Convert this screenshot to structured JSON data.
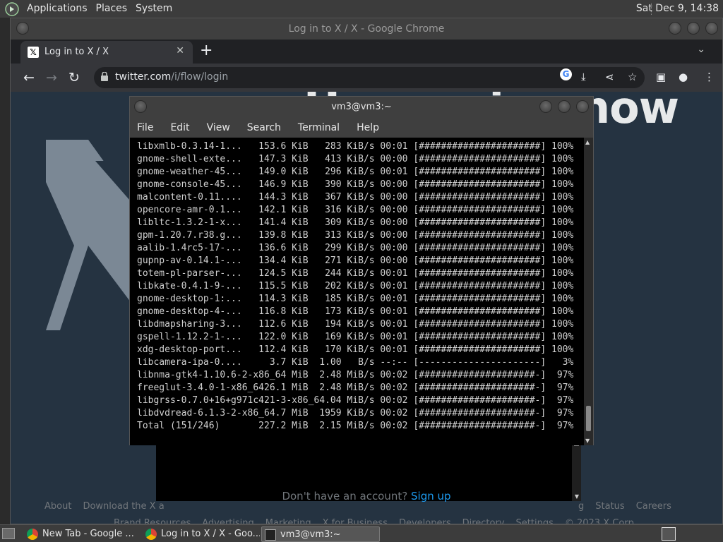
{
  "top_panel": {
    "menus": [
      "Applications",
      "Places",
      "System"
    ],
    "clock": "Sat Dec 9, 14:38"
  },
  "chrome": {
    "window_title": "Log in to X / X - Google Chrome",
    "tab_title": "Log in to X / X",
    "url_host": "twitter.com",
    "url_path": "/i/flow/login"
  },
  "page": {
    "heading_partial": "Happening now",
    "dont_have_account": "Don't have an account?",
    "sign_up": "Sign up",
    "footer_row1": [
      "About",
      "Download the X a",
      "g",
      "Status",
      "Careers"
    ],
    "footer_row2": [
      "Brand Resources",
      "Advertising",
      "Marketing",
      "X for Business",
      "Developers",
      "Directory",
      "Settings",
      "© 2023 X Corp."
    ]
  },
  "terminal": {
    "title": "vm3@vm3:~",
    "menus": [
      "File",
      "Edit",
      "View",
      "Search",
      "Terminal",
      "Help"
    ],
    "lines": [
      "libxmlb-0.3.14-1...   153.6 KiB   283 KiB/s 00:01 [######################] 100%",
      "gnome-shell-exte...   147.3 KiB   413 KiB/s 00:00 [######################] 100%",
      "gnome-weather-45...   149.0 KiB   296 KiB/s 00:01 [######################] 100%",
      "gnome-console-45...   146.9 KiB   390 KiB/s 00:00 [######################] 100%",
      "malcontent-0.11....   144.3 KiB   367 KiB/s 00:00 [######################] 100%",
      "opencore-amr-0.1...   142.1 KiB   316 KiB/s 00:00 [######################] 100%",
      "libltc-1.3.2-1-x...   141.4 KiB   309 KiB/s 00:00 [######################] 100%",
      "gpm-1.20.7.r38.g...   139.8 KiB   313 KiB/s 00:00 [######################] 100%",
      "aalib-1.4rc5-17-...   136.6 KiB   299 KiB/s 00:00 [######################] 100%",
      "gupnp-av-0.14.1-...   134.4 KiB   271 KiB/s 00:00 [######################] 100%",
      "totem-pl-parser-...   124.5 KiB   244 KiB/s 00:01 [######################] 100%",
      "libkate-0.4.1-9-...   115.5 KiB   202 KiB/s 00:01 [######################] 100%",
      "gnome-desktop-1:...   114.3 KiB   185 KiB/s 00:01 [######################] 100%",
      "gnome-desktop-4-...   116.8 KiB   173 KiB/s 00:01 [######################] 100%",
      "libdmapsharing-3...   112.6 KiB   194 KiB/s 00:01 [######################] 100%",
      "gspell-1.12.2-1-...   122.0 KiB   169 KiB/s 00:01 [######################] 100%",
      "xdg-desktop-port...   112.4 KiB   170 KiB/s 00:01 [######################] 100%",
      "libcamera-ipa-0....     3.7 KiB  1.00   B/s --:-- [----------------------]   3%",
      "libnma-gtk4-1.10.6-2-x86_64 MiB  2.48 MiB/s 00:02 [#####################-]  97%",
      "freeglut-3.4.0-1-x86_6426.1 MiB  2.48 MiB/s 00:02 [#####################-]  97%",
      "libgrss-0.7.0+16+g971c421-3-x86_64.04 MiB/s 00:02 [#####################-]  97%",
      "libdvdread-6.1.3-2-x86_64.7 MiB  1959 KiB/s 00:02 [#####################-]  97%",
      "Total (151/246)       227.2 MiB  2.15 MiB/s 00:02 [#####################-]  97%"
    ]
  },
  "taskbar": {
    "tasks": [
      "New Tab - Google ...",
      "Log in to X / X - Goo...",
      "vm3@vm3:~"
    ]
  }
}
